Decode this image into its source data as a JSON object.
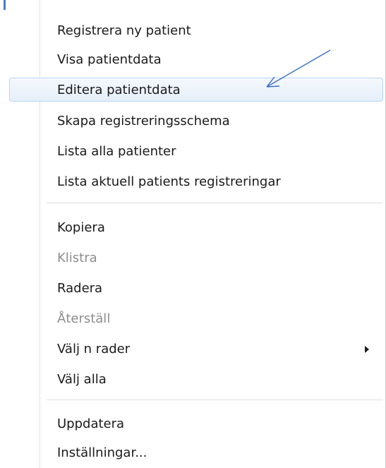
{
  "menu": {
    "group1": [
      {
        "label": "Registrera ny patient",
        "enabled": true
      },
      {
        "label": "Visa patientdata",
        "enabled": true
      },
      {
        "label": "Editera patientdata",
        "enabled": true,
        "highlighted": true
      },
      {
        "label": "Skapa registreringsschema",
        "enabled": true
      },
      {
        "label": "Lista alla patienter",
        "enabled": true
      },
      {
        "label": "Lista aktuell patients registreringar",
        "enabled": true
      }
    ],
    "group2": [
      {
        "label": "Kopiera",
        "enabled": true
      },
      {
        "label": "Klistra",
        "enabled": false
      },
      {
        "label": "Radera",
        "enabled": true
      },
      {
        "label": "Återställ",
        "enabled": false
      },
      {
        "label": "Välj n rader",
        "enabled": true,
        "has_submenu": true
      },
      {
        "label": "Välj alla",
        "enabled": true
      }
    ],
    "group3": [
      {
        "label": "Uppdatera",
        "enabled": true
      },
      {
        "label": "Inställningar...",
        "enabled": true
      }
    ]
  },
  "colors": {
    "highlight_border": "#b8d6fb",
    "disabled_text": "#8d8d8d",
    "annotation_arrow": "#3a6fc4"
  },
  "icons": {
    "submenu": "chevron-right-icon",
    "annotation": "pointer-arrow-icon"
  }
}
